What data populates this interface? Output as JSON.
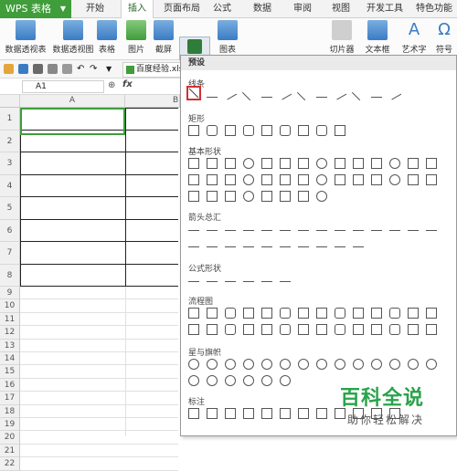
{
  "menubar": {
    "app_button": "WPS 表格",
    "tabs": [
      "开始",
      "插入",
      "页面布局",
      "公式",
      "数据",
      "审阅",
      "视图",
      "开发工具",
      "特色功能"
    ],
    "active_tab": "插入"
  },
  "ribbon": {
    "buttons": [
      "数据透视表",
      "数据透视图",
      "表格",
      "图片",
      "截屏",
      "形状",
      "图表",
      "切片器",
      "文本框",
      "艺术字",
      "符号"
    ]
  },
  "doc": {
    "tab_name": "百度经验.xls"
  },
  "formula_bar": {
    "name_box": "A1",
    "fx": "fx"
  },
  "sheet": {
    "columns": [
      "A",
      "B"
    ],
    "rows": [
      "1",
      "2",
      "3",
      "4",
      "5",
      "6",
      "7",
      "8",
      "9",
      "10",
      "11",
      "12",
      "13",
      "14",
      "15",
      "16",
      "17",
      "18",
      "19",
      "20",
      "21",
      "22"
    ]
  },
  "shapes_panel": {
    "header": "预设",
    "sections": [
      "线条",
      "矩形",
      "基本形状",
      "箭头总汇",
      "公式形状",
      "流程图",
      "星与旗帜",
      "标注"
    ]
  },
  "watermark": {
    "title": "百科全说",
    "subtitle": "助你轻松解决"
  },
  "colors": {
    "accent": "#3f9d3a",
    "selection": "#d03030"
  }
}
